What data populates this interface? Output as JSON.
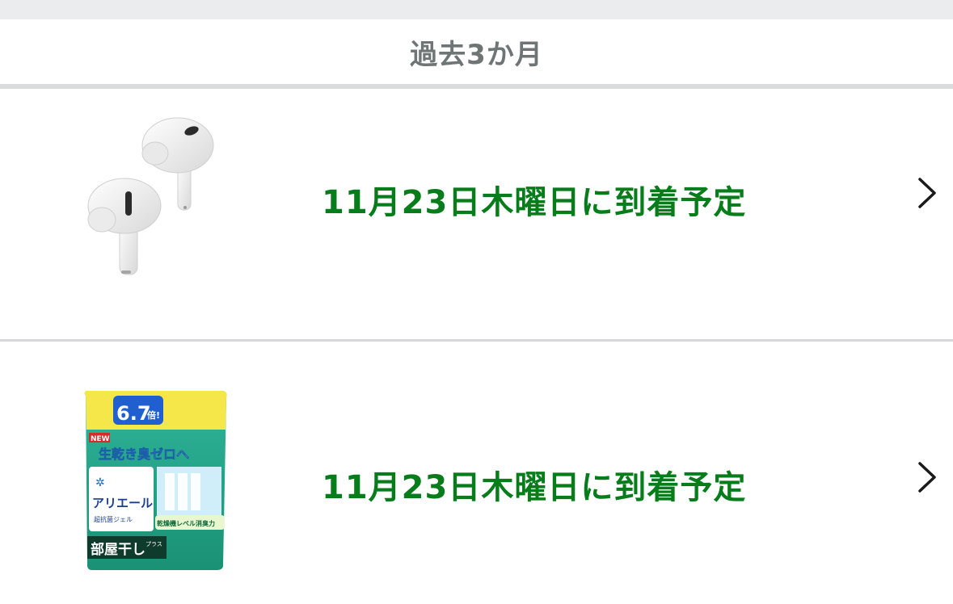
{
  "section": {
    "title": "過去3か月"
  },
  "orders": [
    {
      "product_icon": "earbuds-image",
      "status": "11月23日木曜日に到着予定"
    },
    {
      "product_icon": "detergent-package-image",
      "status": "11月23日木曜日に到着予定",
      "package": {
        "badge_value": "6.7",
        "badge_suffix": "倍!",
        "new_label": "NEW",
        "tagline": "生乾き臭ゼロへ",
        "brand": "アリエール",
        "subbrand": "超抗菌ジェル",
        "feature": "乾燥機レベル消臭力",
        "variant": "部屋干し",
        "variant_suffix": "プラス"
      }
    }
  ],
  "colors": {
    "status_green": "#067d1a",
    "header_gray": "#6f7475",
    "divider": "#d9dcdc",
    "top_band": "#eaeced"
  }
}
